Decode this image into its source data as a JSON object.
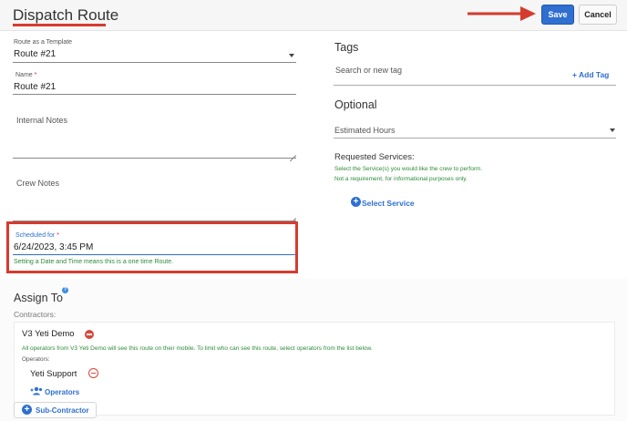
{
  "header": {
    "title": "Dispatch Route",
    "save_label": "Save",
    "cancel_label": "Cancel",
    "accent_red": "#d63b2f",
    "primary_blue": "#2f6fd0"
  },
  "form": {
    "template": {
      "label": "Route as a Template",
      "value": "Route #21"
    },
    "name": {
      "label": "Name",
      "required_mark": "*",
      "value": "Route #21"
    },
    "internal_notes": {
      "label": "Internal Notes"
    },
    "crew_notes": {
      "label": "Crew Notes"
    },
    "scheduled": {
      "label": "Scheduled for",
      "required_mark": "*",
      "value": "6/24/2023, 3:45 PM",
      "hint": "Setting a Date and Time means this is a one time Route."
    }
  },
  "tags": {
    "title": "Tags",
    "placeholder": "Search or new tag",
    "add_label": "+ Add Tag"
  },
  "optional": {
    "title": "Optional",
    "estimated_hours_placeholder": "Estimated Hours",
    "requested_services_title": "Requested Services:",
    "note_line1": "Select the Service(s) you would like the crew to perform.",
    "note_line2": "Not a requirement, for informational purposes only.",
    "select_service_label": "Select Service"
  },
  "assign": {
    "title": "Assign To",
    "help_glyph": "?",
    "contractors_label": "Contractors:",
    "contractor": {
      "name": "V3 Yeti Demo",
      "note": "All operators from V3 Yeti Demo will see this route on their mobile. To limit who can see this route, select operators from the list below.",
      "operators_label": "Operators:",
      "operator_name": "Yeti Support",
      "operators_link": "Operators"
    },
    "subcontractor_label": "Sub-Contractor"
  }
}
